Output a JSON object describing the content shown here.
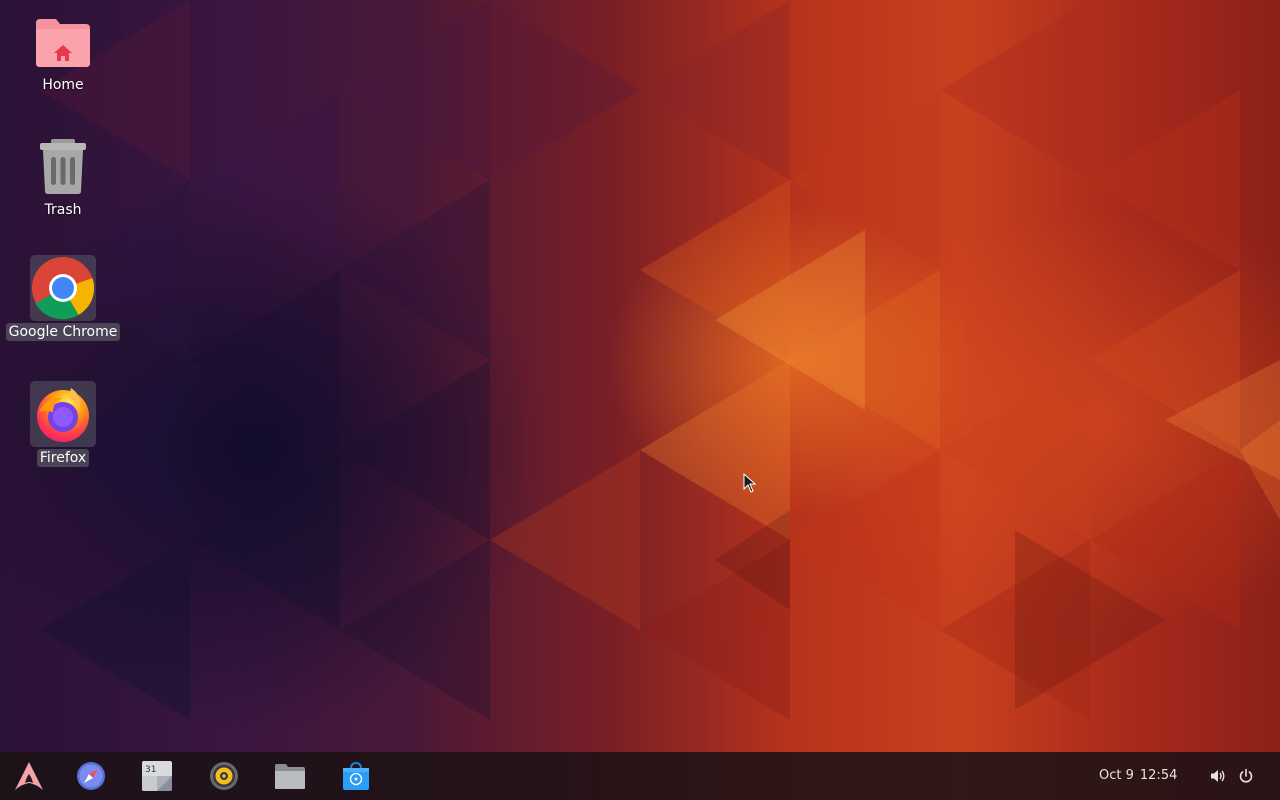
{
  "desktop": {
    "icons": [
      {
        "label": "Home",
        "icon": "home-folder-icon"
      },
      {
        "label": "Trash",
        "icon": "trash-icon"
      },
      {
        "label": "Google Chrome",
        "icon": "chrome-icon"
      },
      {
        "label": "Firefox",
        "icon": "firefox-icon"
      }
    ]
  },
  "taskbar": {
    "items": [
      {
        "name": "app-menu",
        "icon": "arch-logo-icon"
      },
      {
        "name": "web-browser",
        "icon": "compass-icon"
      },
      {
        "name": "calendar",
        "icon": "calendar-icon",
        "day": "31"
      },
      {
        "name": "music",
        "icon": "speaker-music-icon"
      },
      {
        "name": "files",
        "icon": "folder-icon"
      },
      {
        "name": "software-store",
        "icon": "store-bag-icon"
      }
    ],
    "clock": {
      "date": "Oct 9",
      "time": "12:54"
    },
    "tray": [
      {
        "name": "volume",
        "icon": "volume-icon"
      },
      {
        "name": "power",
        "icon": "power-icon"
      }
    ]
  },
  "colors": {
    "home_folder": "#f87f8c",
    "taskbar_bg": "#1c1216",
    "accent_orange": "#e8641e"
  }
}
